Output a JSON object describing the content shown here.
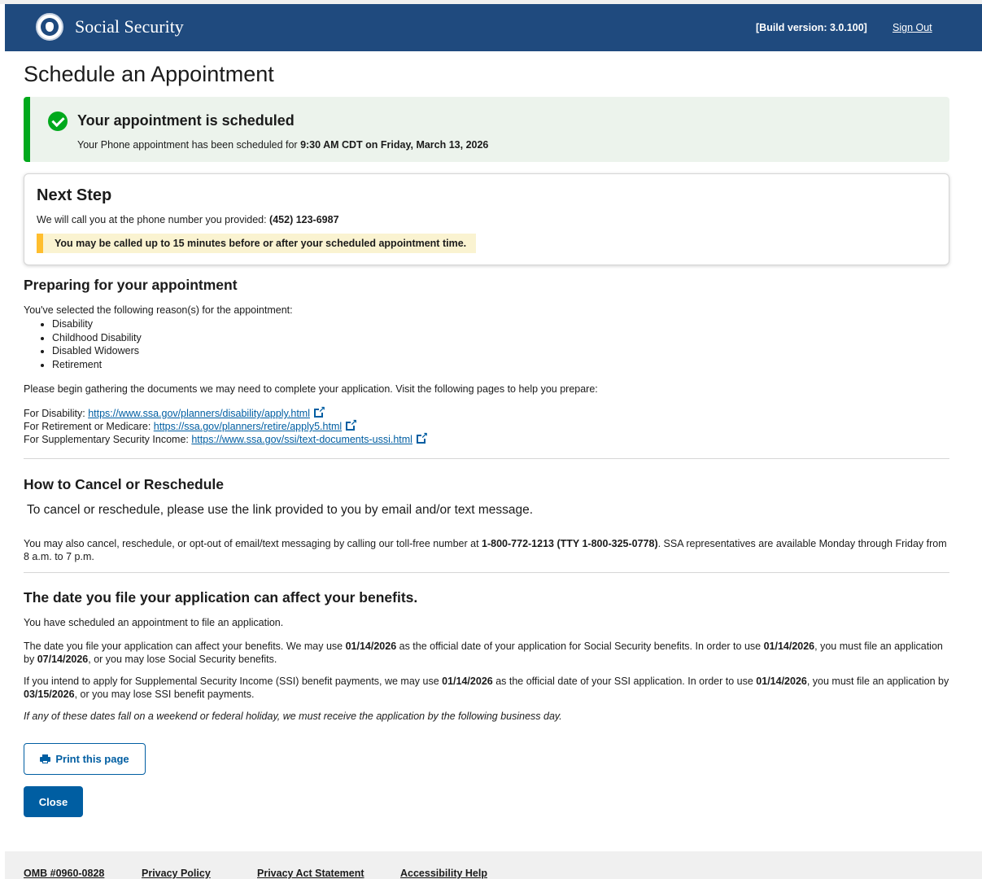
{
  "header": {
    "brand": "Social Security",
    "build_version": "[Build version: 3.0.100]",
    "sign_out": "Sign Out"
  },
  "page_title": "Schedule an Appointment",
  "success": {
    "heading": "Your appointment is scheduled",
    "text_prefix": "Your Phone appointment has been scheduled for ",
    "time": "9:30 AM CDT on Friday, March 13, 2026"
  },
  "next_step": {
    "title": "Next Step",
    "text_prefix": "We will call you at the phone number you provided: ",
    "phone": "(452) 123-6987",
    "warning": "You may be called up to 15 minutes before or after your scheduled appointment time."
  },
  "preparing": {
    "heading": "Preparing for your appointment",
    "intro": "You've selected the following reason(s) for the appointment:",
    "reasons": [
      "Disability",
      "Childhood Disability",
      "Disabled Widowers",
      "Retirement"
    ],
    "gather_text": "Please begin gathering the documents we may need to complete your application. Visit the following pages to help you prepare:",
    "links": [
      {
        "label": "For Disability: ",
        "url": "https://www.ssa.gov/planners/disability/apply.html"
      },
      {
        "label": "For Retirement or Medicare: ",
        "url": "https://ssa.gov/planners/retire/apply5.html"
      },
      {
        "label": "For Supplementary Security Income: ",
        "url": "https://www.ssa.gov/ssi/text-documents-ussi.html"
      }
    ]
  },
  "cancel": {
    "heading": "How to Cancel or Reschedule",
    "main_text": "To cancel or reschedule, please use the link provided to you by email and/or text message.",
    "phone_text_1": "You may also cancel, reschedule, or opt-out of email/text messaging by calling our toll-free number at ",
    "phone_numbers": "1-800-772-1213 (TTY 1-800-325-0778)",
    "phone_text_2": ". SSA representatives are available Monday through Friday from 8 a.m. to 7 p.m."
  },
  "filing": {
    "heading": "The date you file your application can affect your benefits.",
    "scheduled_text": "You have scheduled an appointment to file an application.",
    "ss_text_1": "The date you file your application can affect your benefits. We may use ",
    "ss_date": "01/14/2026",
    "ss_text_2": " as the official date of your application for Social Security benefits. In order to use ",
    "ss_date_2": "01/14/2026",
    "ss_text_3": ", you must file an application by ",
    "ss_deadline": "07/14/2026",
    "ss_text_4": ", or you may lose Social Security benefits.",
    "ssi_text_1": "If you intend to apply for Supplemental Security Income (SSI) benefit payments, we may use ",
    "ssi_date": "01/14/2026",
    "ssi_text_2": " as the official date of your SSI application. In order to use ",
    "ssi_date_2": "01/14/2026",
    "ssi_text_3": ", you must file an application by ",
    "ssi_deadline": "03/15/2026",
    "ssi_text_4": ", or you may lose SSI benefit payments.",
    "holiday_note": "If any of these dates fall on a weekend or federal holiday, we must receive the application by the following business day."
  },
  "buttons": {
    "print": "Print this page",
    "close": "Close"
  },
  "footer": {
    "omb": "OMB #0960-0828",
    "privacy_policy": "Privacy Policy",
    "privacy_act": "Privacy Act Statement",
    "accessibility": "Accessibility Help"
  },
  "colors": {
    "header_bg": "#1f4a7e",
    "success_accent": "#00a91c",
    "warning_accent": "#ffbe2e",
    "link": "#005ea2"
  }
}
